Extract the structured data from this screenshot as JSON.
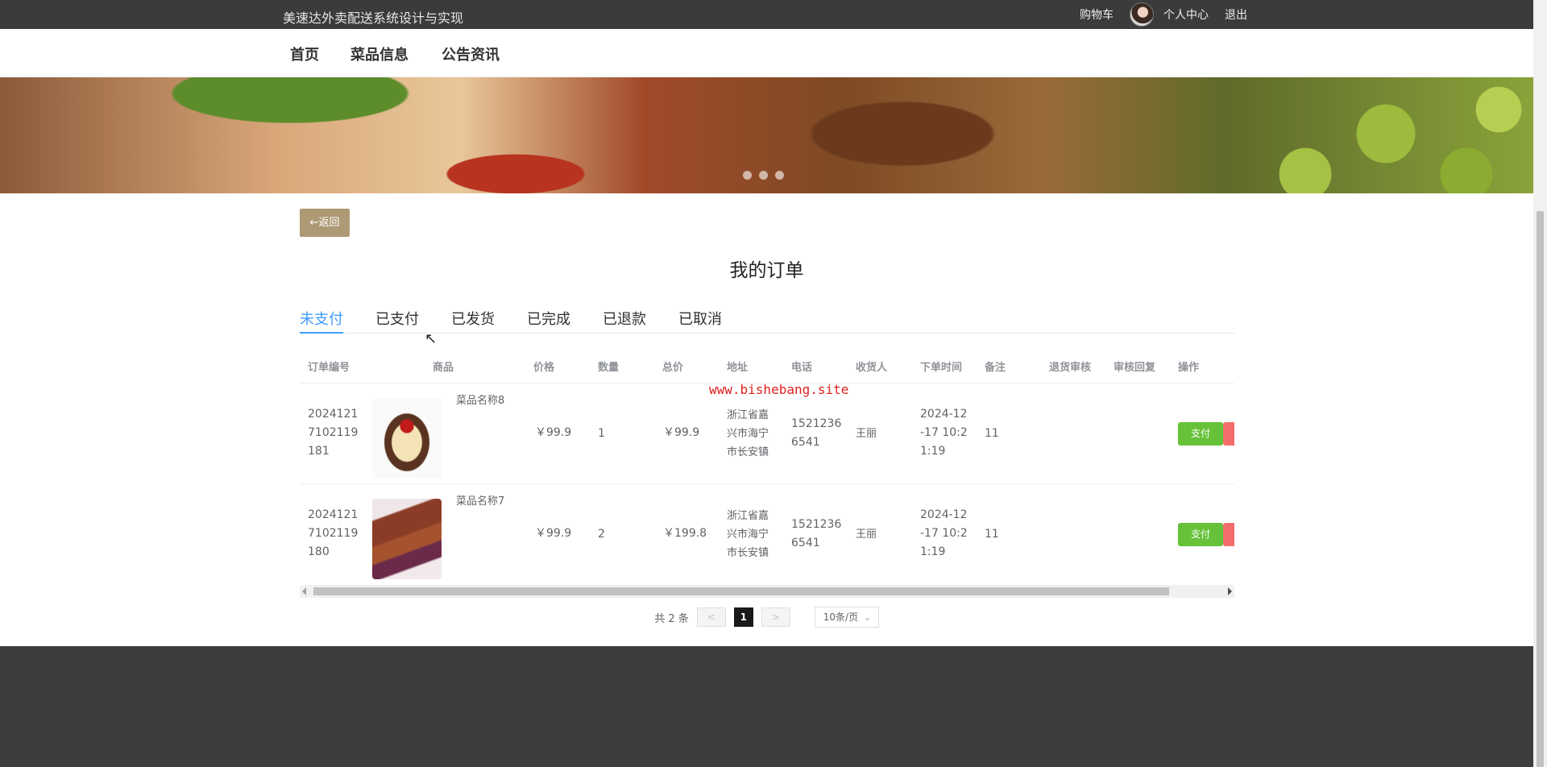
{
  "header": {
    "site_title": "美速达外卖配送系统设计与实现",
    "cart": "购物车",
    "profile": "个人中心",
    "logout": "退出"
  },
  "nav": [
    "首页",
    "菜品信息",
    "公告资讯"
  ],
  "back_button": "←返回",
  "page_title": "我的订单",
  "tabs": [
    "未支付",
    "已支付",
    "已发货",
    "已完成",
    "已退款",
    "已取消"
  ],
  "active_tab": "未支付",
  "table": {
    "columns": [
      "订单编号",
      "商品",
      "价格",
      "数量",
      "总价",
      "地址",
      "电话",
      "收货人",
      "下单时间",
      "备注",
      "退货审核",
      "审核回复",
      "操作"
    ],
    "rows": [
      {
        "order_no": [
          "2024121",
          "7102119",
          "181"
        ],
        "product": "菜品名称8",
        "image": "dessert-image",
        "price": "￥99.9",
        "qty": "1",
        "total": "￥99.9",
        "address": [
          "浙江省嘉",
          "兴市海宁",
          "市长安镇"
        ],
        "phone": [
          "1521236",
          "6541"
        ],
        "receiver": "王丽",
        "time": [
          "2024-12",
          "-17 10:2",
          "1:19"
        ],
        "note": "11",
        "pay_button": "支付"
      },
      {
        "order_no": [
          "2024121",
          "7102119",
          "180"
        ],
        "product": "菜品名称7",
        "image": "skewer-image",
        "price": "￥99.9",
        "qty": "2",
        "total": "￥199.8",
        "address": [
          "浙江省嘉",
          "兴市海宁",
          "市长安镇"
        ],
        "phone": [
          "1521236",
          "6541"
        ],
        "receiver": "王丽",
        "time": [
          "2024-12",
          "-17 10:2",
          "1:19"
        ],
        "note": "11",
        "pay_button": "支付"
      }
    ]
  },
  "watermark": "www.bishebang.site",
  "pagination": {
    "total": "共 2 条",
    "prev": "<",
    "current": "1",
    "next": ">",
    "page_size": "10条/页"
  },
  "colors": {
    "topbar": "#3b3b3b",
    "accent": "#409eff",
    "back_button": "#ad9a74",
    "pay": "#67c23a",
    "danger": "#f56c6c",
    "footer": "#3d3d3d"
  }
}
